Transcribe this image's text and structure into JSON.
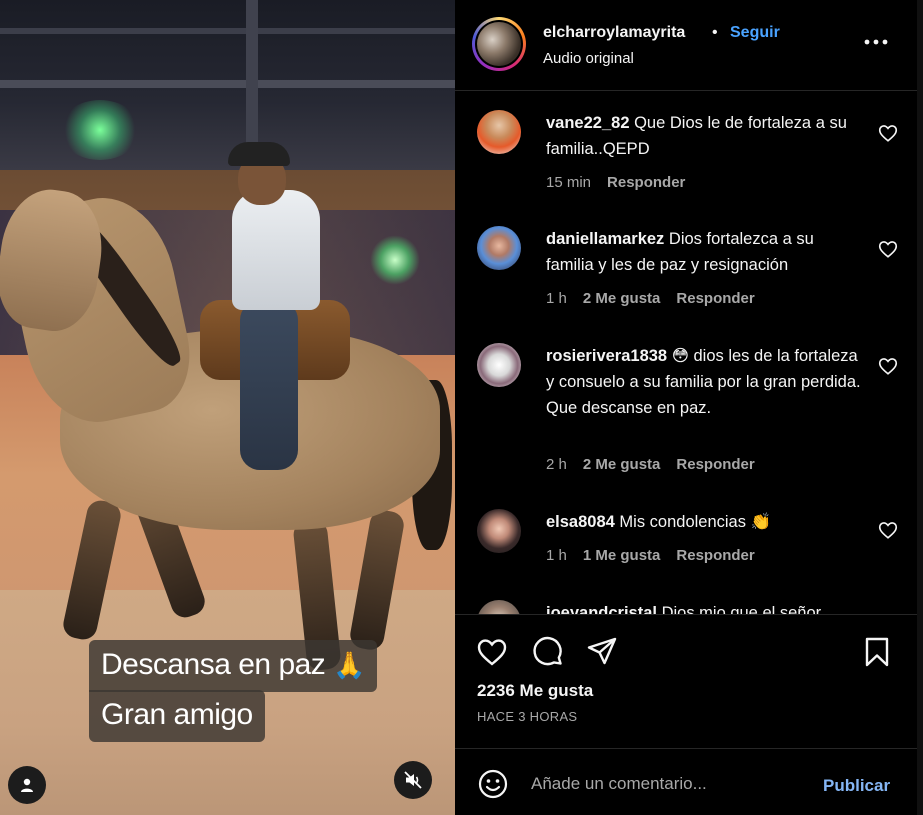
{
  "media": {
    "caption_line1": "Descansa en paz",
    "caption_emoji": "🙏",
    "caption_line2": "Gran amigo",
    "user_button_icon": "user-icon",
    "mute_button_icon": "muted-speaker-icon"
  },
  "header": {
    "username": "elcharroylamayrita",
    "separator": "•",
    "follow_label": "Seguir",
    "audio_label": "Audio original",
    "more_icon": "more-options-icon"
  },
  "comments": [
    {
      "username": "vane22_82",
      "text": "Que Dios le de fortaleza a su familia..QEPD",
      "time": "15 min",
      "likes": "",
      "reply": "Responder"
    },
    {
      "username": "daniellamarkez",
      "text": "Dios fortalezca a su familia y les de paz y resignación",
      "time": "1 h",
      "likes": "2 Me gusta",
      "reply": "Responder"
    },
    {
      "username": "rosierivera1838",
      "text": "😳 dios les de la fortaleza y consuelo a su familia por la gran perdida. Que descanse en paz.",
      "time": "2 h",
      "likes": "2 Me gusta",
      "reply": "Responder"
    },
    {
      "username": "elsa8084",
      "text": "Mis condolencias 👏",
      "time": "1 h",
      "likes": "1 Me gusta",
      "reply": "Responder"
    },
    {
      "username": "joeyandcristal",
      "text": "Dios mio que el señor",
      "time": "",
      "likes": "",
      "reply": ""
    }
  ],
  "actions": {
    "like_icon": "heart-icon",
    "comment_icon": "comment-icon",
    "share_icon": "share-icon",
    "save_icon": "bookmark-icon",
    "likes_total": "2236 Me gusta",
    "time_ago": "HACE 3 HORAS"
  },
  "composer": {
    "emoji_icon": "emoji-icon",
    "placeholder": "Añade un comentario...",
    "publish_label": "Publicar"
  },
  "colors": {
    "background": "#000000",
    "follow_blue": "#4aa3ff",
    "publish_blue": "#85b6f5",
    "muted_text": "#a8a8a8",
    "divider": "#262626"
  }
}
